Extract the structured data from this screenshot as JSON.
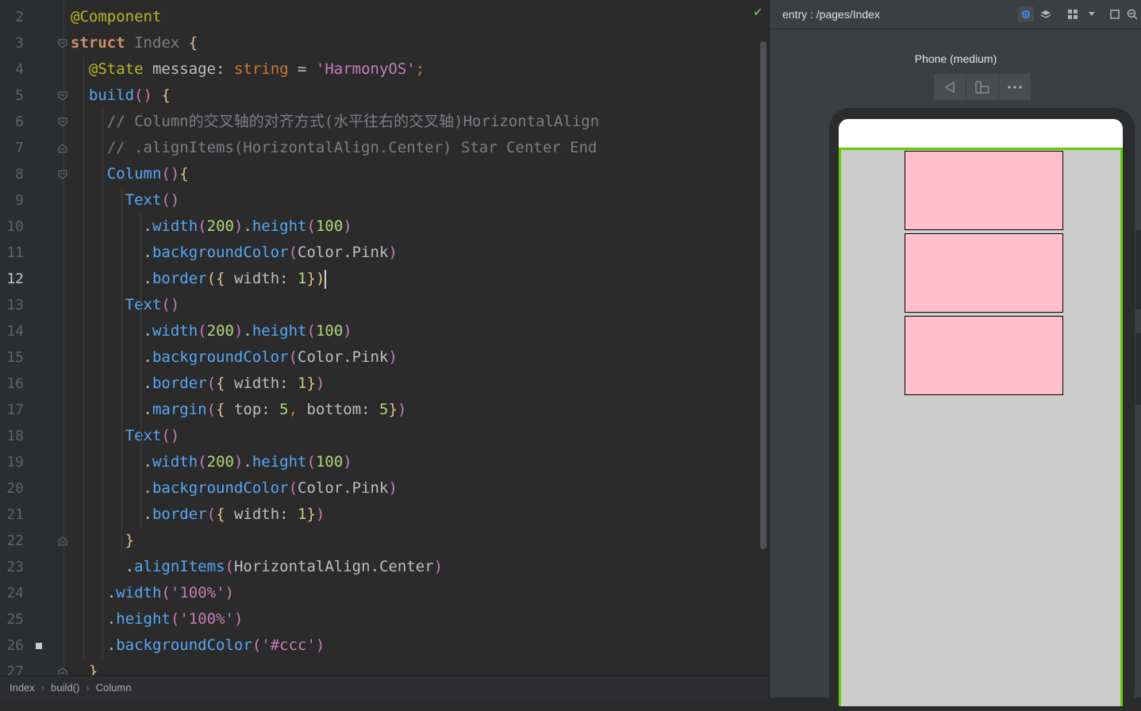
{
  "editor": {
    "status_check": "✔",
    "lines": [
      {
        "n": "2",
        "tokens": [
          [
            "@Component",
            "d"
          ]
        ]
      },
      {
        "n": "3",
        "tokens": [
          [
            "struct ",
            "k"
          ],
          [
            "Index ",
            "cls"
          ],
          [
            "{",
            "y"
          ]
        ]
      },
      {
        "n": "4",
        "tokens": [
          [
            "  ",
            "p"
          ],
          [
            "@State ",
            "d"
          ],
          [
            "message",
            "t"
          ],
          [
            ": ",
            "p"
          ],
          [
            "string ",
            "ty"
          ],
          [
            "= ",
            "p"
          ],
          [
            "'HarmonyOS'",
            "s"
          ],
          [
            ";",
            "ty"
          ]
        ]
      },
      {
        "n": "5",
        "tokens": [
          [
            "  ",
            "p"
          ],
          [
            "build",
            "fn"
          ],
          [
            "() ",
            "br2"
          ],
          [
            "{",
            "y"
          ]
        ]
      },
      {
        "n": "6",
        "tokens": [
          [
            "    ",
            "p"
          ],
          [
            "// Column的交叉轴的对齐方式(水平往右的交叉轴)HorizontalAlign",
            "c"
          ]
        ]
      },
      {
        "n": "7",
        "tokens": [
          [
            "    ",
            "p"
          ],
          [
            "// .alignItems(HorizontalAlign.Center) Star Center End",
            "c"
          ]
        ]
      },
      {
        "n": "8",
        "tokens": [
          [
            "    ",
            "p"
          ],
          [
            "Column",
            "fn"
          ],
          [
            "()",
            "br2"
          ],
          [
            "{",
            "y"
          ]
        ]
      },
      {
        "n": "9",
        "tokens": [
          [
            "      ",
            "p"
          ],
          [
            "Text",
            "fn"
          ],
          [
            "()",
            "br2"
          ]
        ]
      },
      {
        "n": "10",
        "tokens": [
          [
            "        ",
            "p"
          ],
          [
            ".",
            "p"
          ],
          [
            "width",
            "m"
          ],
          [
            "(",
            "br2"
          ],
          [
            "200",
            "n2"
          ],
          [
            ")",
            "br2"
          ],
          [
            ".",
            "p"
          ],
          [
            "height",
            "m"
          ],
          [
            "(",
            "br2"
          ],
          [
            "100",
            "n2"
          ],
          [
            ")",
            "br2"
          ]
        ]
      },
      {
        "n": "11",
        "tokens": [
          [
            "        ",
            "p"
          ],
          [
            ".",
            "p"
          ],
          [
            "backgroundColor",
            "m"
          ],
          [
            "(",
            "br2"
          ],
          [
            "Color",
            "t"
          ],
          [
            ".",
            "p"
          ],
          [
            "Pink",
            "t"
          ],
          [
            ")",
            "br2"
          ]
        ]
      },
      {
        "n": "12",
        "tokens": [
          [
            "        ",
            "p"
          ],
          [
            ".",
            "p"
          ],
          [
            "border",
            "m"
          ],
          [
            "(",
            "ylw"
          ],
          [
            "{ ",
            "y"
          ],
          [
            "width",
            "t"
          ],
          [
            ": ",
            "p"
          ],
          [
            "1",
            "n2"
          ],
          [
            "}",
            "y"
          ],
          [
            ")",
            "ylw"
          ]
        ]
      },
      {
        "n": "13",
        "tokens": [
          [
            "      ",
            "p"
          ],
          [
            "Text",
            "fn"
          ],
          [
            "()",
            "br2"
          ]
        ]
      },
      {
        "n": "14",
        "tokens": [
          [
            "        ",
            "p"
          ],
          [
            ".",
            "p"
          ],
          [
            "width",
            "m"
          ],
          [
            "(",
            "br2"
          ],
          [
            "200",
            "n2"
          ],
          [
            ")",
            "br2"
          ],
          [
            ".",
            "p"
          ],
          [
            "height",
            "m"
          ],
          [
            "(",
            "br2"
          ],
          [
            "100",
            "n2"
          ],
          [
            ")",
            "br2"
          ]
        ]
      },
      {
        "n": "15",
        "tokens": [
          [
            "        ",
            "p"
          ],
          [
            ".",
            "p"
          ],
          [
            "backgroundColor",
            "m"
          ],
          [
            "(",
            "br2"
          ],
          [
            "Color",
            "t"
          ],
          [
            ".",
            "p"
          ],
          [
            "Pink",
            "t"
          ],
          [
            ")",
            "br2"
          ]
        ]
      },
      {
        "n": "16",
        "tokens": [
          [
            "        ",
            "p"
          ],
          [
            ".",
            "p"
          ],
          [
            "border",
            "m"
          ],
          [
            "(",
            "br2"
          ],
          [
            "{ ",
            "y"
          ],
          [
            "width",
            "t"
          ],
          [
            ": ",
            "p"
          ],
          [
            "1",
            "n2"
          ],
          [
            "}",
            "y"
          ],
          [
            ")",
            "br2"
          ]
        ]
      },
      {
        "n": "17",
        "tokens": [
          [
            "        ",
            "p"
          ],
          [
            ".",
            "p"
          ],
          [
            "margin",
            "m"
          ],
          [
            "(",
            "br2"
          ],
          [
            "{ ",
            "y"
          ],
          [
            "top",
            "t"
          ],
          [
            ": ",
            "p"
          ],
          [
            "5",
            "n2"
          ],
          [
            ", ",
            "ty"
          ],
          [
            "bottom",
            "t"
          ],
          [
            ": ",
            "p"
          ],
          [
            "5",
            "n2"
          ],
          [
            "}",
            "y"
          ],
          [
            ")",
            "br2"
          ]
        ]
      },
      {
        "n": "18",
        "tokens": [
          [
            "      ",
            "p"
          ],
          [
            "Text",
            "fn"
          ],
          [
            "()",
            "br2"
          ]
        ]
      },
      {
        "n": "19",
        "tokens": [
          [
            "        ",
            "p"
          ],
          [
            ".",
            "p"
          ],
          [
            "width",
            "m"
          ],
          [
            "(",
            "br2"
          ],
          [
            "200",
            "n2"
          ],
          [
            ")",
            "br2"
          ],
          [
            ".",
            "p"
          ],
          [
            "height",
            "m"
          ],
          [
            "(",
            "br2"
          ],
          [
            "100",
            "n2"
          ],
          [
            ")",
            "br2"
          ]
        ]
      },
      {
        "n": "20",
        "tokens": [
          [
            "        ",
            "p"
          ],
          [
            ".",
            "p"
          ],
          [
            "backgroundColor",
            "m"
          ],
          [
            "(",
            "br2"
          ],
          [
            "Color",
            "t"
          ],
          [
            ".",
            "p"
          ],
          [
            "Pink",
            "t"
          ],
          [
            ")",
            "br2"
          ]
        ]
      },
      {
        "n": "21",
        "tokens": [
          [
            "        ",
            "p"
          ],
          [
            ".",
            "p"
          ],
          [
            "border",
            "m"
          ],
          [
            "(",
            "br2"
          ],
          [
            "{ ",
            "y"
          ],
          [
            "width",
            "t"
          ],
          [
            ": ",
            "p"
          ],
          [
            "1",
            "n2"
          ],
          [
            "}",
            "y"
          ],
          [
            ")",
            "br2"
          ]
        ]
      },
      {
        "n": "22",
        "tokens": [
          [
            "      ",
            "p"
          ],
          [
            "}",
            "y"
          ]
        ]
      },
      {
        "n": "23",
        "tokens": [
          [
            "      ",
            "p"
          ],
          [
            ".",
            "p"
          ],
          [
            "alignItems",
            "m"
          ],
          [
            "(",
            "br2"
          ],
          [
            "HorizontalAlign",
            "t"
          ],
          [
            ".",
            "p"
          ],
          [
            "Center",
            "t"
          ],
          [
            ")",
            "br2"
          ]
        ]
      },
      {
        "n": "24",
        "tokens": [
          [
            "    ",
            "p"
          ],
          [
            ".",
            "p"
          ],
          [
            "width",
            "m"
          ],
          [
            "(",
            "br2"
          ],
          [
            "'100%'",
            "s"
          ],
          [
            ")",
            "br2"
          ]
        ]
      },
      {
        "n": "25",
        "tokens": [
          [
            "    ",
            "p"
          ],
          [
            ".",
            "p"
          ],
          [
            "height",
            "m"
          ],
          [
            "(",
            "br2"
          ],
          [
            "'100%'",
            "s"
          ],
          [
            ")",
            "br2"
          ]
        ]
      },
      {
        "n": "26",
        "tokens": [
          [
            "    ",
            "p"
          ],
          [
            ".",
            "p"
          ],
          [
            "backgroundColor",
            "m"
          ],
          [
            "(",
            "br2"
          ],
          [
            "'#ccc'",
            "s"
          ],
          [
            ")",
            "br2"
          ]
        ]
      },
      {
        "n": "27",
        "tokens": [
          [
            "  ",
            "p"
          ],
          [
            "}",
            "y"
          ]
        ]
      }
    ],
    "current_line": "12"
  },
  "breadcrumb": {
    "items": [
      "Index",
      "build()",
      "Column"
    ],
    "separator": "›"
  },
  "previewer": {
    "title": "entry : /pages/Index",
    "device_name": "Phone (medium)",
    "toolbar_icons": [
      "inspector-icon",
      "layers-icon",
      "multi-device-icon",
      "dropdown-chevron-icon",
      "fit-screen-icon",
      "zoom-out-icon"
    ],
    "device_toolbar_icons": [
      "back-icon",
      "rotate-icon",
      "more-icon"
    ],
    "boxes": 3,
    "colors": {
      "column_bg": "#cccccc",
      "column_border": "#66cc00",
      "box_bg": "#ffc0cb"
    }
  }
}
